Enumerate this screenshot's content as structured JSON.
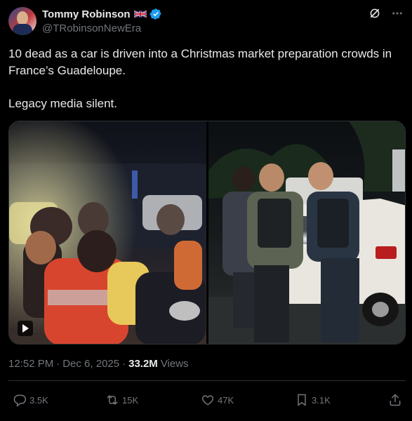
{
  "author": {
    "display_name": "Tommy Robinson",
    "handle": "@TRobinsonNewEra"
  },
  "tweet": {
    "text": "10 dead as a car is driven into a Christmas market preparation crowds in France’s Guadeloupe.\n\nLegacy media silent."
  },
  "meta": {
    "time": "12:52 PM",
    "date": "Dec 6, 2025",
    "separator": "·",
    "views_count": "33.2M",
    "views_label": "Views"
  },
  "actions": {
    "replies": "3.5K",
    "reposts": "15K",
    "likes": "47K",
    "bookmarks": "3.1K"
  },
  "colors": {
    "background": "#000000",
    "text": "#e7e9ea",
    "secondary": "#71767b",
    "verified": "#1d9bf0",
    "divider": "#2f3336"
  },
  "icons": [
    "flag-uk-icon",
    "verified-badge-icon",
    "grok-icon",
    "more-icon",
    "play-icon",
    "reply-icon",
    "repost-icon",
    "like-icon",
    "bookmark-icon",
    "share-icon"
  ]
}
